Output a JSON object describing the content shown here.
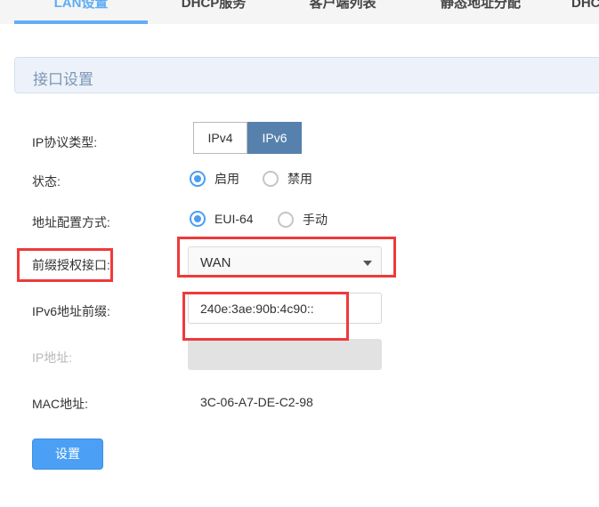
{
  "tabs": [
    {
      "label": "LAN设置",
      "active": true
    },
    {
      "label": "DHCP服务",
      "active": false
    },
    {
      "label": "客户端列表",
      "active": false
    },
    {
      "label": "静态地址分配",
      "active": false
    },
    {
      "label": "DHCP",
      "active": false
    }
  ],
  "panel": {
    "title": "接口设置"
  },
  "form": {
    "ip_protocol": {
      "label": "IP协议类型:",
      "options": [
        "IPv4",
        "IPv6"
      ],
      "selected": "IPv6"
    },
    "status": {
      "label": "状态:",
      "options": [
        {
          "label": "启用",
          "checked": true
        },
        {
          "label": "禁用",
          "checked": false
        }
      ]
    },
    "addr_config": {
      "label": "地址配置方式:",
      "options": [
        {
          "label": "EUI-64",
          "checked": true
        },
        {
          "label": "手动",
          "checked": false
        }
      ]
    },
    "prefix_interface": {
      "label": "前缀授权接口:",
      "value": "WAN"
    },
    "ipv6_prefix": {
      "label": "IPv6地址前缀:",
      "value": "240e:3ae:90b:4c90::"
    },
    "ip_address": {
      "label": "IP地址:",
      "value": ""
    },
    "mac_address": {
      "label": "MAC地址:",
      "value": "3C-06-A7-DE-C2-98"
    },
    "submit_label": "设置"
  },
  "colors": {
    "accent": "#4ba0f5",
    "segment_active": "#5781ad",
    "annotation": "#ee3a3a"
  }
}
